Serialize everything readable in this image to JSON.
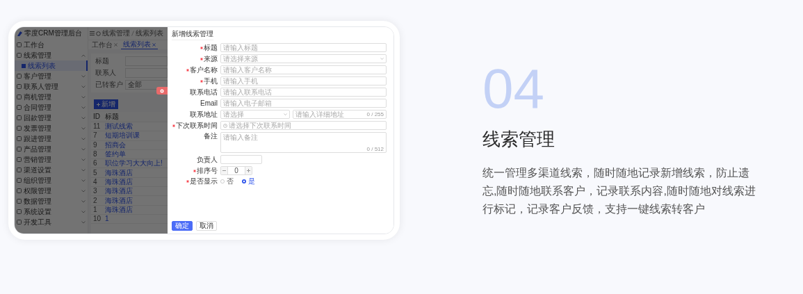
{
  "showcase": {
    "number": "04",
    "title": "线索管理",
    "description": "统一管理多渠道线索，随时随地记录新增线索，防止遗忘,随时随地联系客户，记录联系内容,随时随地对线索进行标记，记录客户反馈，支持一键线索转客户"
  },
  "app": {
    "brand": "零度CRM管理后台",
    "breadcrumb": [
      "线索管理",
      "线索列表"
    ],
    "sidebar": {
      "items": [
        {
          "label": "工作台",
          "kind": "link",
          "selected": false
        },
        {
          "label": "线索管理",
          "kind": "group",
          "expanded": true,
          "children": [
            {
              "label": "线索列表",
              "selected": true
            }
          ]
        },
        {
          "label": "客户管理",
          "kind": "group",
          "expanded": false
        },
        {
          "label": "联系人管理",
          "kind": "group",
          "expanded": false
        },
        {
          "label": "商机管理",
          "kind": "group",
          "expanded": false
        },
        {
          "label": "合同管理",
          "kind": "group",
          "expanded": false
        },
        {
          "label": "回款管理",
          "kind": "group",
          "expanded": false
        },
        {
          "label": "发票管理",
          "kind": "group",
          "expanded": false
        },
        {
          "label": "跟进管理",
          "kind": "group",
          "expanded": false
        },
        {
          "label": "产品管理",
          "kind": "group",
          "expanded": false
        },
        {
          "label": "营销管理",
          "kind": "group",
          "expanded": false
        },
        {
          "label": "渠道设置",
          "kind": "group",
          "expanded": false
        },
        {
          "label": "组织管理",
          "kind": "group",
          "expanded": false
        },
        {
          "label": "权限管理",
          "kind": "group",
          "expanded": false
        },
        {
          "label": "数据管理",
          "kind": "group",
          "expanded": false
        },
        {
          "label": "系统设置",
          "kind": "group",
          "expanded": false
        },
        {
          "label": "开发工具",
          "kind": "group",
          "expanded": false
        }
      ]
    },
    "tabs": [
      {
        "label": "工作台",
        "selected": false
      },
      {
        "label": "线索列表",
        "selected": true
      }
    ],
    "filters": [
      {
        "label": "标题"
      },
      {
        "label": "联系人"
      },
      {
        "label": "已转客户",
        "value": "全部"
      }
    ],
    "add_button": "新增",
    "table": {
      "columns": [
        "ID",
        "标题"
      ],
      "rows": [
        [
          "11",
          "测试线索"
        ],
        [
          "7",
          "短期培训课"
        ],
        [
          "9",
          "招商会"
        ],
        [
          "8",
          "签约单"
        ],
        [
          "6",
          "职位学习大大向上!"
        ],
        [
          "5",
          "海珠酒店"
        ],
        [
          "4",
          "海珠酒店"
        ],
        [
          "3",
          "海珠酒店"
        ],
        [
          "2",
          "海珠酒店"
        ],
        [
          "1",
          "海珠酒店"
        ],
        [
          "10",
          "1"
        ]
      ]
    },
    "drawer": {
      "title": "新增线索管理",
      "fields": [
        {
          "label": "标题",
          "kind": "text",
          "required": true,
          "placeholder": "请输入标题"
        },
        {
          "label": "来源",
          "kind": "select",
          "required": true,
          "placeholder": "请选择来源"
        },
        {
          "label": "客户名称",
          "kind": "text",
          "required": true,
          "placeholder": "请输入客户名称"
        },
        {
          "label": "手机",
          "kind": "text",
          "required": true,
          "placeholder": "请输入手机"
        },
        {
          "label": "联系电话",
          "kind": "text",
          "required": false,
          "placeholder": "请输入联系电话"
        },
        {
          "label": "Email",
          "kind": "text",
          "required": false,
          "placeholder": "请输入电子邮箱"
        },
        {
          "label": "联系地址",
          "kind": "address",
          "required": false,
          "placeholder": "请选择",
          "detail_placeholder": "请输入详细地址",
          "counter": "0 / 255"
        },
        {
          "label": "下次联系时间",
          "kind": "date",
          "required": true,
          "placeholder": "请选择下次联系时间"
        },
        {
          "label": "备注",
          "kind": "textarea",
          "required": false,
          "placeholder": "请输入备注",
          "counter": "0 / 512"
        },
        {
          "label": "负责人",
          "kind": "short",
          "required": false
        },
        {
          "label": "排序号",
          "kind": "number",
          "required": true,
          "value": "0"
        },
        {
          "label": "是否显示",
          "kind": "radio",
          "required": true,
          "options": [
            {
              "label": "否",
              "selected": false
            },
            {
              "label": "是",
              "selected": true
            }
          ]
        }
      ],
      "buttons": [
        {
          "label": "确定",
          "kind": "primary"
        },
        {
          "label": "取消",
          "kind": "default"
        }
      ]
    }
  }
}
